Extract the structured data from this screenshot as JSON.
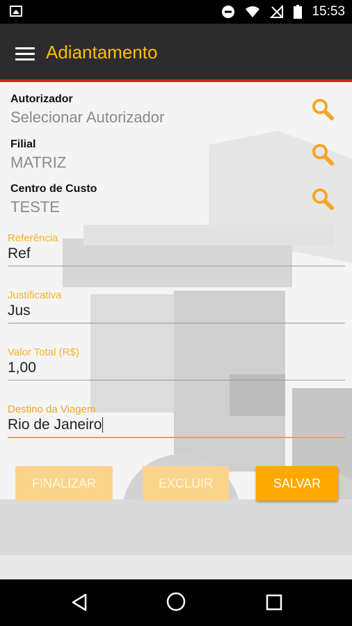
{
  "status": {
    "time": "15:53"
  },
  "appbar": {
    "title": "Adiantamento",
    "accent": "#ffbf00",
    "divider_color": "#d8201e"
  },
  "lookups": [
    {
      "label": "Autorizador",
      "value": "Selecionar Autorizador"
    },
    {
      "label": "Filial",
      "value": "MATRIZ"
    },
    {
      "label": "Centro de Custo",
      "value": "TESTE"
    }
  ],
  "fields": [
    {
      "label": "Referência",
      "value": "Ref"
    },
    {
      "label": "Justificativa",
      "value": "Jus"
    },
    {
      "label": "Valor Total (R$)",
      "value": "1,00"
    },
    {
      "label": "Destino da Viagem",
      "value": "Rio de Janeiro"
    }
  ],
  "buttons": {
    "finalizar": "FINALIZAR",
    "excluir": "EXCLUIR",
    "salvar": "SALVAR"
  },
  "icons": {
    "status_left": "image-icon",
    "status_right": [
      "do-not-disturb-icon",
      "wifi-icon",
      "no-signal-icon",
      "battery-icon"
    ],
    "lookup": "search-icon",
    "nav": [
      "back-icon",
      "home-icon",
      "recent-apps-icon"
    ]
  }
}
